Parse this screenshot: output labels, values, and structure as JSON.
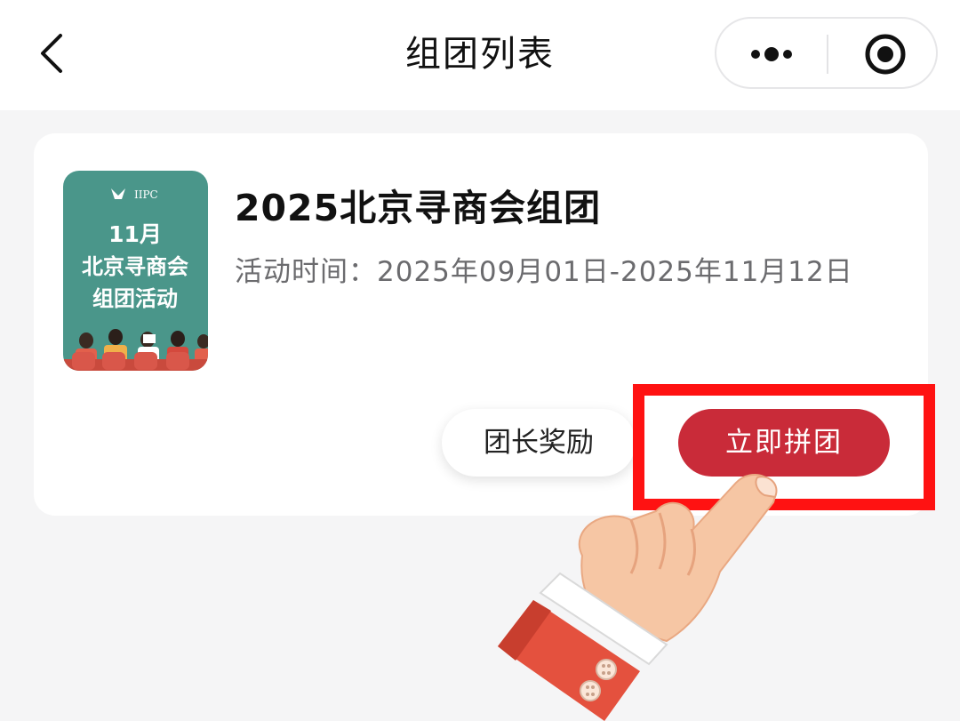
{
  "navbar": {
    "title": "组团列表",
    "back_icon": "chevron-left-icon",
    "more_icon": "more-dots-icon",
    "close_icon": "target-circle-icon"
  },
  "card": {
    "title": "2025北京寻商会组团",
    "time_text": "活动时间：2025年09月01日-2025年11月12日",
    "poster": {
      "line1": "11月",
      "line2": "北京寻商会",
      "line3": "组团活动",
      "logo_text": "IIPC",
      "background": "#4a968a"
    },
    "buttons": {
      "reward_label": "团长奖励",
      "join_label": "立即拼团"
    }
  },
  "annotation": {
    "highlight_color": "#ff1212",
    "pointer": "pointing-hand-icon"
  },
  "colors": {
    "accent": "#c92b39",
    "page_bg": "#f5f5f6"
  }
}
